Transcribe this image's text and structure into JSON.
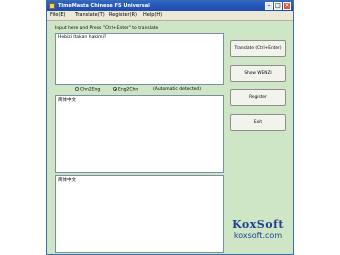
{
  "window": {
    "title": "TimeMasta Chinese FS Universal"
  },
  "menu": {
    "items": [
      {
        "label": "File(E)"
      },
      {
        "label": "Translate(T)"
      },
      {
        "label": "Register(R)"
      },
      {
        "label": "Help(H)"
      }
    ]
  },
  "main": {
    "prompt": "Input here and Press \"Ctrl+Enter\" to translate",
    "source_text": "Hebizi Itakan hakimi?",
    "result_text": "简体中文",
    "pinyin_text": "简体中文"
  },
  "options": {
    "radio_one": "Chn2Eng",
    "radio_one_selected": false,
    "radio_two": "Eng2Chn",
    "radio_two_selected": true,
    "auto_note": "(Automatic detected)"
  },
  "buttons": {
    "translate": "Translate (Ctrl+Enter)",
    "wenzi": "Show WENZI",
    "register": "Register",
    "exit": "Exit"
  },
  "logo": {
    "brand": "KoxSoft",
    "url": "koxsoft.com"
  },
  "colors": {
    "window_bg": "#cfe6c6",
    "titlebar": "#1d4ba8",
    "logo": "#1f3f8f"
  }
}
